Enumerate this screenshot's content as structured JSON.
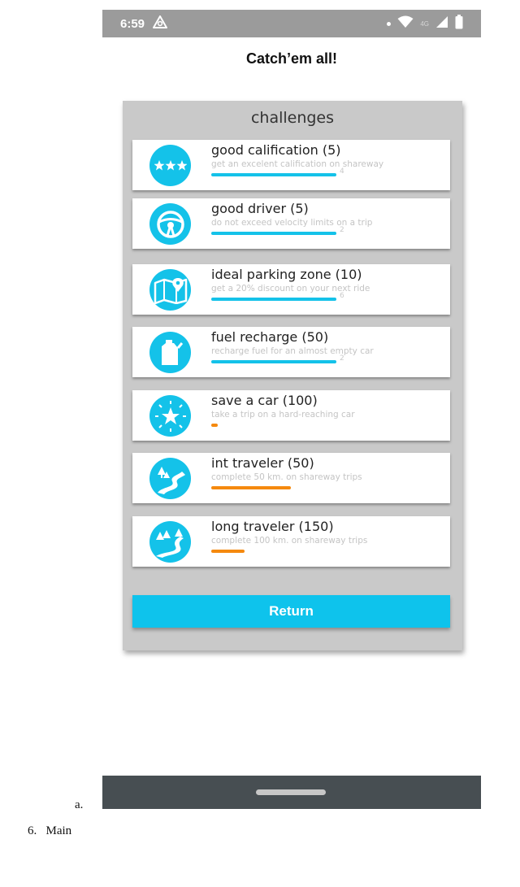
{
  "status_bar": {
    "time": "6:59",
    "network_label": "4G",
    "icons": [
      "notification-a-icon",
      "dot-icon",
      "wifi-icon",
      "signal-icon",
      "battery-icon"
    ]
  },
  "app_title": "Catch’em all!",
  "panel_title": "challenges",
  "challenges": [
    {
      "name": "good calification (5)",
      "desc": "get an excelent calification on shareway",
      "count": "4",
      "progress_color": "#14c2e9",
      "icon": "three-stars-icon"
    },
    {
      "name": "good driver (5)",
      "desc": "do not exceed velocity limits on a trip",
      "count": "2",
      "progress_color": "#14c2e9",
      "icon": "steering-wheel-icon"
    },
    {
      "name": "ideal parking zone (10)",
      "desc": "get a 20% discount on your next ride",
      "count": "6",
      "progress_color": "#14c2e9",
      "icon": "map-pin-icon"
    },
    {
      "name": "fuel recharge (50)",
      "desc": "recharge fuel for an almost empty car",
      "count": "2",
      "progress_color": "#14c2e9",
      "icon": "fuel-can-icon"
    },
    {
      "name": "save a car (100)",
      "desc": "take a trip on a hard-reaching car",
      "count": "",
      "progress_color": "#f5890e",
      "icon": "star-burst-icon"
    },
    {
      "name": "int traveler (50)",
      "desc": "complete 50 km. on shareway trips",
      "count": "",
      "progress_color": "#f5890e",
      "icon": "winding-road-icon"
    },
    {
      "name": "long traveler (150)",
      "desc": "complete 100 km. on shareway trips",
      "count": "",
      "progress_color": "#f5890e",
      "icon": "long-road-icon"
    }
  ],
  "return_label": "Return",
  "doc": {
    "item_a": "a.",
    "section_6": "6.   Main"
  },
  "colors": {
    "accent": "#14c2e9",
    "progress_incomplete": "#f5890e",
    "panel": "#c9c9c9",
    "nav_bar": "#474e52"
  }
}
